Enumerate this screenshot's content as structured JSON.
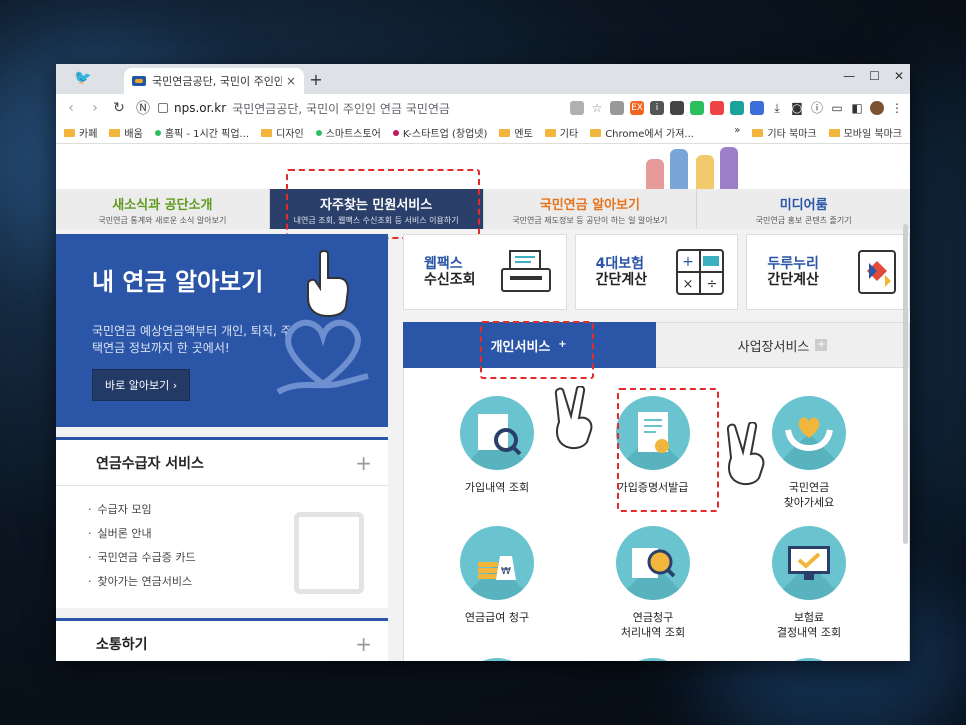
{
  "browser": {
    "tab_title": "국민연금공단, 국민이 주인인 연금 국민연금",
    "new_tab": "+",
    "tab_close": "×",
    "window_controls": [
      "—",
      "☐",
      "✕"
    ],
    "url_domain": "nps.or.kr",
    "url_rest": "국민연금공단, 국민이 주인인 연금 국민연금",
    "bookmarks": [
      "카페",
      "배움",
      "홈픽 - 1시간 픽업...",
      "디자인",
      "스마트스토어",
      "K-스타트업 (창업넷)",
      "멘토",
      "기타",
      "Chrome에서 가져..."
    ],
    "bookmarks_more": "»",
    "bookmarks_right": [
      "기타 북마크",
      "모바일 북마크"
    ]
  },
  "gnb": [
    {
      "title": "새소식과 공단소개",
      "sub": "국민연금 통계와 새로운 소식 알아보기",
      "color": "#5f9a1c"
    },
    {
      "title": "자주찾는 민원서비스",
      "sub": "내연금 조회, 웹팩스 수신조회 등 서비스 이용하기",
      "color": "#ffffff"
    },
    {
      "title": "국민연금 알아보기",
      "sub": "국민연금 제도정보 등 공단이 하는 일 알아보기",
      "color": "#e7731d"
    },
    {
      "title": "미디어룸",
      "sub": "국민연금 홍보 콘텐츠 즐기기",
      "color": "#2b55a6"
    }
  ],
  "banner": {
    "title": "내 연금 알아보기",
    "desc": "국민연금 예상연금액부터 개인, 퇴직, 주택연금 정보까지 한 곳에서!",
    "button": "바로 알아보기 ›"
  },
  "panel1": {
    "title": "연금수급자 서비스",
    "plus": "+",
    "items": [
      "수급자 모임",
      "실버론 안내",
      "국민연금 수급증 카드",
      "찾아가는 연금서비스"
    ]
  },
  "panel2": {
    "title": "소통하기",
    "plus": "+"
  },
  "quick": [
    {
      "a": "웹팩스",
      "b": "수신조회"
    },
    {
      "a": "4대보험",
      "b": "간단계산"
    },
    {
      "a": "두루누리",
      "b": "간단계산"
    }
  ],
  "tabs": {
    "on": "개인서비스",
    "on_plus": "+",
    "off": "사업장서비스",
    "off_plus": "+"
  },
  "services": [
    {
      "label": "가입내역 조회"
    },
    {
      "label": "가입증명서발급"
    },
    {
      "label": "국민연금\n찾아가세요"
    },
    {
      "label": "연금급여 청구"
    },
    {
      "label": "연금청구\n처리내역 조회"
    },
    {
      "label": "보험료\n결정내역 조회"
    }
  ],
  "colors": {
    "accent": "#2b55a6",
    "highlight": "#e22b2b",
    "service_circle": "#69c4cf"
  }
}
